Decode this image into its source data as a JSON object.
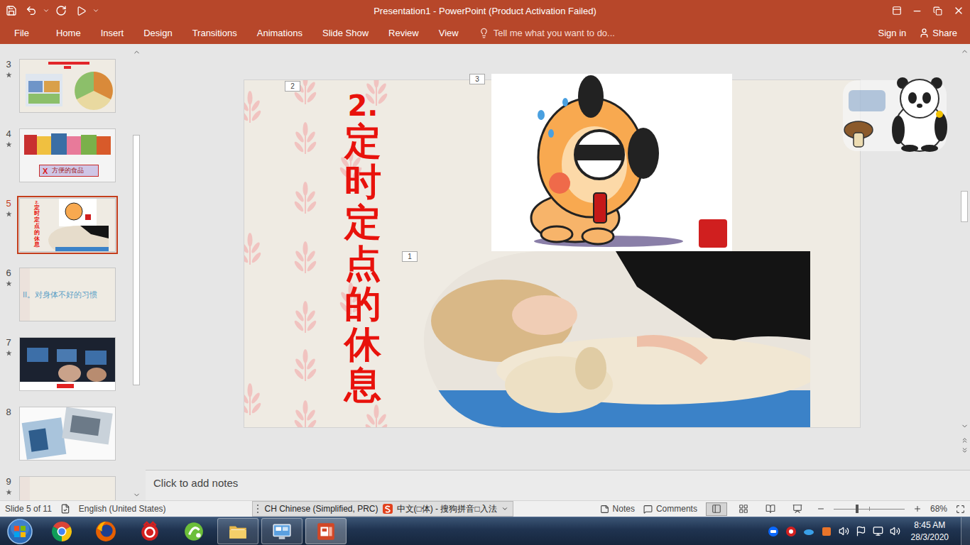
{
  "window": {
    "title": "Presentation1 - PowerPoint (Product Activation Failed)"
  },
  "ribbon_tabs": [
    {
      "label": "File",
      "selected": false
    },
    {
      "label": "Home",
      "selected": false
    },
    {
      "label": "Insert",
      "selected": false
    },
    {
      "label": "Design",
      "selected": false
    },
    {
      "label": "Transitions",
      "selected": false
    },
    {
      "label": "Animations",
      "selected": false
    },
    {
      "label": "Slide Show",
      "selected": false
    },
    {
      "label": "Review",
      "selected": false
    },
    {
      "label": "View",
      "selected": false
    }
  ],
  "tell_me": {
    "placeholder": "Tell me what you want to do..."
  },
  "account": {
    "sign_in": "Sign in",
    "share": "Share"
  },
  "thumbnail_pane": {
    "scroll_position": 0.18,
    "scroll_size": 0.58
  },
  "thumbnails": [
    {
      "number": "3",
      "kind": "food",
      "selected": false,
      "animated": true
    },
    {
      "number": "4",
      "kind": "banner",
      "selected": false,
      "animated": true,
      "mark": "X",
      "caption": "方便的食品"
    },
    {
      "number": "5",
      "kind": "current",
      "selected": true,
      "animated": true
    },
    {
      "number": "6",
      "kind": "heading",
      "selected": false,
      "animated": true,
      "caption": "II。对身体不好的习惯"
    },
    {
      "number": "7",
      "kind": "photo",
      "selected": false,
      "animated": true
    },
    {
      "number": "8",
      "kind": "collage",
      "selected": false,
      "animated": false
    },
    {
      "number": "9",
      "kind": "cut",
      "selected": false,
      "animated": true
    }
  ],
  "slide": {
    "number": "2.",
    "title": "定时定点的休息",
    "objects": [
      {
        "kind": "title",
        "tag": "2"
      },
      {
        "kind": "cartoon",
        "tag": "3"
      },
      {
        "kind": "photo",
        "tag": "1"
      }
    ]
  },
  "editor_scrollbar": {
    "position": 0.37,
    "size": 0.086
  },
  "notes": {
    "placeholder": "Click to add notes"
  },
  "status_bar": {
    "slide": "Slide 5 of 11",
    "language": "English (United States)",
    "notes": "Notes",
    "comments": "Comments",
    "views": [
      {
        "kind": "normal",
        "selected": true
      },
      {
        "kind": "sorter",
        "selected": false
      },
      {
        "kind": "reading",
        "selected": false
      },
      {
        "kind": "slideshow",
        "selected": false
      }
    ],
    "zoom": "68%",
    "zoom_level": 0.33
  },
  "language_bar": {
    "language": "CH Chinese (Simplified, PRC)",
    "input_method": "中文(□体) - 搜狗拼音□入法"
  },
  "taskbar": {
    "apps": [
      {
        "kind": "chrome",
        "running": false,
        "active": false
      },
      {
        "kind": "firefox",
        "running": false,
        "active": false
      },
      {
        "kind": "garena",
        "running": false,
        "active": false
      },
      {
        "kind": "green",
        "running": false,
        "active": false
      },
      {
        "kind": "folder",
        "running": true,
        "active": false
      },
      {
        "kind": "control",
        "running": true,
        "active": false
      },
      {
        "kind": "powerpoint",
        "running": true,
        "active": true
      }
    ],
    "time": "8:45 AM",
    "date": "28/3/2020"
  }
}
